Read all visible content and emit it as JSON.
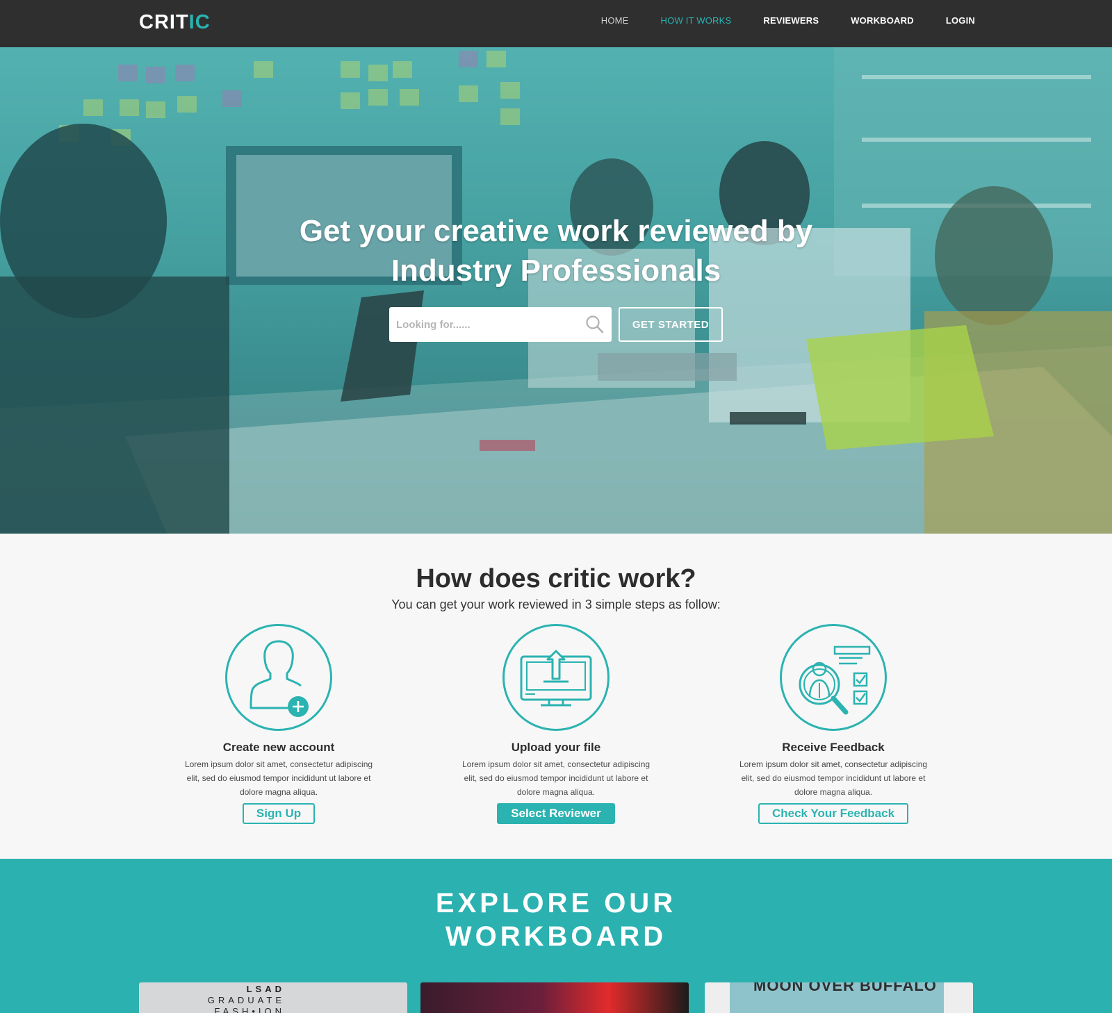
{
  "nav": {
    "logo_main": "CRIT",
    "logo_accent": "IC",
    "links": [
      "HOME",
      "HOW IT WORKS",
      "REVIEWERS",
      "WORKBOARD",
      "LOGIN"
    ]
  },
  "hero": {
    "title_line1": "Get your creative work reviewed by",
    "title_line2": "Industry Professionals",
    "search_placeholder": "Looking for......",
    "cta_label": "GET STARTED"
  },
  "how": {
    "title": "How does critic work?",
    "subtitle": "You can get your work reviewed in 3 simple steps as follow:",
    "steps": [
      {
        "icon": "add-user-icon",
        "title": "Create new account",
        "text": "Lorem ipsum dolor sit amet, consectetur adipiscing elit, sed do eiusmod tempor incididunt ut labore et dolore magna aliqua.",
        "button": "Sign Up"
      },
      {
        "icon": "upload-monitor-icon",
        "title": "Upload your file",
        "text": "Lorem ipsum dolor sit amet, consectetur adipiscing elit, sed do eiusmod tempor incididunt ut labore et dolore magna aliqua.",
        "button": "Select Reviewer"
      },
      {
        "icon": "review-checklist-icon",
        "title": "Receive Feedback",
        "text": "Lorem ipsum dolor sit amet, consectetur adipiscing elit, sed do eiusmod tempor incididunt ut labore et dolore magna aliqua.",
        "button": "Check Your Feedback"
      }
    ]
  },
  "explore": {
    "title_line1": "EXPLORE OUR",
    "title_line2": "WORKBOARD",
    "card1_text": [
      "LSAD",
      "GRADUATE",
      "FASH•ION"
    ],
    "card3_text": "MOON OVER BUFFALO"
  },
  "colors": {
    "accent": "#2bb3b1",
    "nav_bg": "#2f2f2f",
    "explore_bg": "#2bb1b0"
  }
}
